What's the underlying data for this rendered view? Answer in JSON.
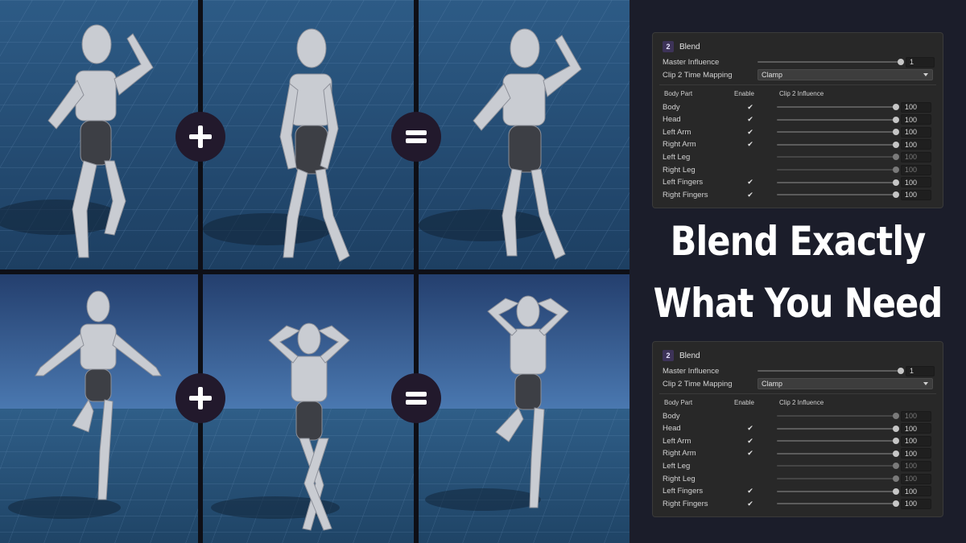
{
  "headline": {
    "line1": "Blend Exactly",
    "line2": "What You Need"
  },
  "colors": {
    "page_background": "#1b1d2a",
    "panel_background": "#282828",
    "operator_circle": "#22192c",
    "badge": "#3d3358",
    "floor_blue": "#2f5e88",
    "sky_blue": "#3c69a6"
  },
  "grid": {
    "operators": [
      {
        "row": "top",
        "symbol": "plus-icon"
      },
      {
        "row": "top",
        "symbol": "equals-icon"
      },
      {
        "row": "bottom",
        "symbol": "plus-icon"
      },
      {
        "row": "bottom",
        "symbol": "equals-icon"
      }
    ],
    "figures": [
      {
        "row": "top",
        "pose": "left-arm-raised"
      },
      {
        "row": "top",
        "pose": "standing-relaxed"
      },
      {
        "row": "top",
        "pose": "combined-arm-raised"
      },
      {
        "row": "bottom",
        "pose": "arms-out-leg-raised"
      },
      {
        "row": "bottom",
        "pose": "hands-behind-head"
      },
      {
        "row": "bottom",
        "pose": "combined-hands-head-leg-raised"
      }
    ]
  },
  "panels": [
    {
      "badge": "2",
      "title": "Blend",
      "master_label": "Master Influence",
      "master_value": "1",
      "master_fraction": 1.0,
      "mapping_label": "Clip 2 Time Mapping",
      "mapping_value": "Clamp",
      "col_body_part": "Body Part",
      "col_enable": "Enable",
      "col_influence": "Clip 2 Influence",
      "rows": [
        {
          "part": "Body",
          "enabled": true,
          "value": "100",
          "fraction": 1.0
        },
        {
          "part": "Head",
          "enabled": true,
          "value": "100",
          "fraction": 1.0
        },
        {
          "part": "Left Arm",
          "enabled": true,
          "value": "100",
          "fraction": 1.0
        },
        {
          "part": "Right Arm",
          "enabled": true,
          "value": "100",
          "fraction": 1.0
        },
        {
          "part": "Left Leg",
          "enabled": false,
          "value": "100",
          "fraction": 1.0
        },
        {
          "part": "Right Leg",
          "enabled": false,
          "value": "100",
          "fraction": 1.0
        },
        {
          "part": "Left Fingers",
          "enabled": true,
          "value": "100",
          "fraction": 1.0
        },
        {
          "part": "Right Fingers",
          "enabled": true,
          "value": "100",
          "fraction": 1.0
        }
      ]
    },
    {
      "badge": "2",
      "title": "Blend",
      "master_label": "Master Influence",
      "master_value": "1",
      "master_fraction": 1.0,
      "mapping_label": "Clip 2 Time Mapping",
      "mapping_value": "Clamp",
      "col_body_part": "Body Part",
      "col_enable": "Enable",
      "col_influence": "Clip 2 Influence",
      "rows": [
        {
          "part": "Body",
          "enabled": false,
          "value": "100",
          "fraction": 1.0
        },
        {
          "part": "Head",
          "enabled": true,
          "value": "100",
          "fraction": 1.0
        },
        {
          "part": "Left Arm",
          "enabled": true,
          "value": "100",
          "fraction": 1.0
        },
        {
          "part": "Right Arm",
          "enabled": true,
          "value": "100",
          "fraction": 1.0
        },
        {
          "part": "Left Leg",
          "enabled": false,
          "value": "100",
          "fraction": 1.0
        },
        {
          "part": "Right Leg",
          "enabled": false,
          "value": "100",
          "fraction": 1.0
        },
        {
          "part": "Left Fingers",
          "enabled": true,
          "value": "100",
          "fraction": 1.0
        },
        {
          "part": "Right Fingers",
          "enabled": true,
          "value": "100",
          "fraction": 1.0
        }
      ]
    }
  ]
}
